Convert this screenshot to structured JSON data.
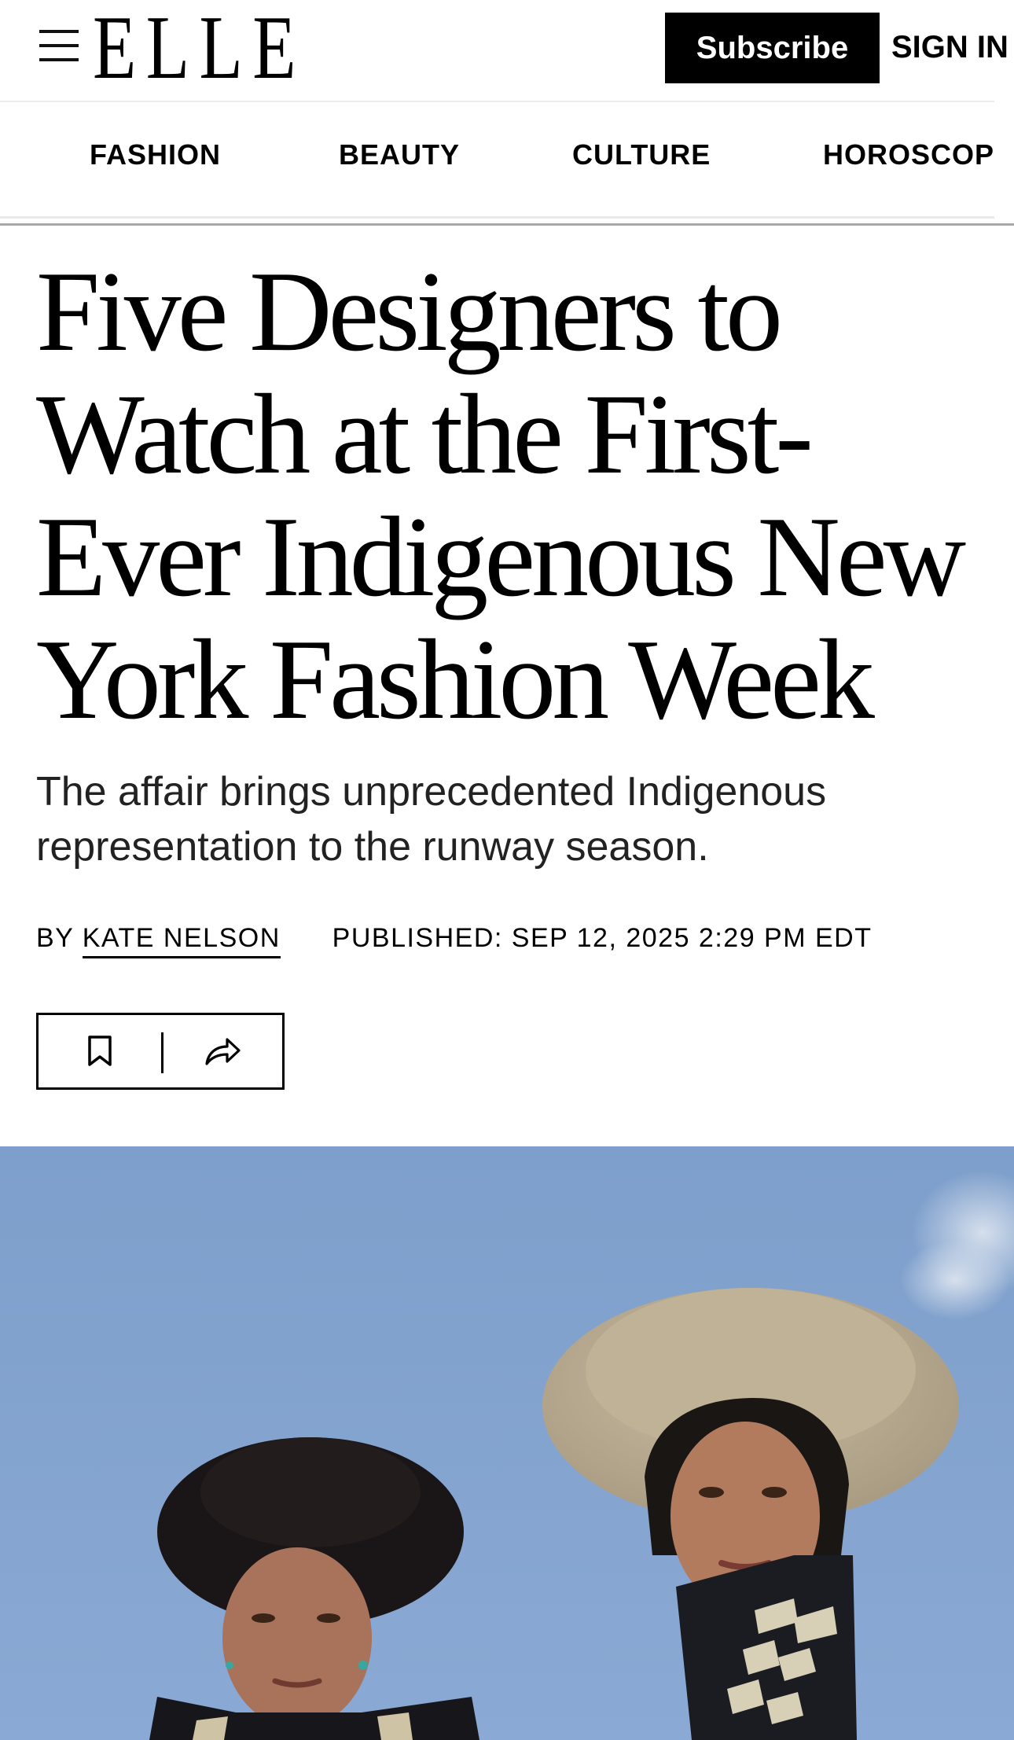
{
  "header": {
    "logo": "ELLE",
    "subscribe_label": "Subscribe",
    "signin_label": "SIGN IN"
  },
  "nav": {
    "items": [
      {
        "label": "FASHION"
      },
      {
        "label": "BEAUTY"
      },
      {
        "label": "CULTURE"
      },
      {
        "label": "HOROSCOPI"
      }
    ]
  },
  "article": {
    "headline": "Five Designers to Watch at the First-Ever Indigenous New York Fashion Week",
    "dek": "The affair brings unprecedented Indigenous representation to the runway season.",
    "byline_prefix": "BY",
    "author": "KATE NELSON",
    "published": "PUBLISHED: SEP 12, 2025 2:29 PM EDT"
  },
  "icons": {
    "menu": "hamburger-menu-icon",
    "save": "bookmark-icon",
    "share": "share-arrow-icon"
  },
  "colors": {
    "background": "#ffffff",
    "text": "#000000",
    "button": "#000000",
    "sky": "#7fa0cc"
  }
}
